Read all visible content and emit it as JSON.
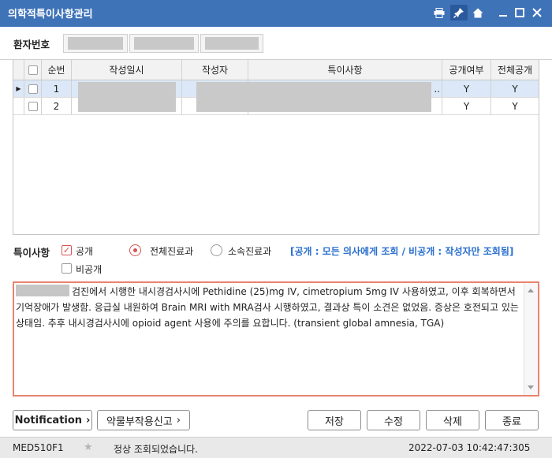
{
  "window": {
    "title": "의학적특이사항관리",
    "icons": [
      "print-icon",
      "pin-icon",
      "home-icon",
      "minimize-icon",
      "maximize-icon",
      "close-icon"
    ]
  },
  "patient": {
    "label": "환자번호"
  },
  "grid": {
    "columns": [
      "순번",
      "작성일시",
      "작성자",
      "특이사항",
      "공개여부",
      "전체공개"
    ],
    "rows": [
      {
        "no": "1",
        "remark_tail": "..",
        "public": "Y",
        "all_public": "Y"
      },
      {
        "no": "2",
        "public": "Y",
        "all_public": "Y"
      }
    ]
  },
  "options": {
    "label": "특이사항",
    "public": "공개",
    "private": "비공개",
    "all_dept": "전체진료과",
    "own_dept": "소속진료과",
    "notice": "[공개 : 모든 의사에게 조회 / 비공개 : 작성자만 조회됨]"
  },
  "memo": {
    "text": "검진에서 시행한 내시경검사시에 Pethidine (25)mg IV, cimetropium 5mg IV 사용하였고, 이후 회복하면서 기억장애가 발생함. 응급실 내원하여 Brain MRI with MRA검사 시행하였고, 결과상 특이 소견은 없었음. 증상은 호전되고 있는 상태임. 추후 내시경검사시에 opioid agent 사용에 주의를 요합니다.   (transient global amnesia, TGA)"
  },
  "buttons": {
    "notification": "Notification",
    "adr_report": "약물부작용신고",
    "save": "저장",
    "edit": "수정",
    "delete": "삭제",
    "close": "종료"
  },
  "status": {
    "screen_id": "MED510F1",
    "message": "정상 조회되었습니다.",
    "datetime": "2022-07-03  10:42:47:305"
  },
  "colors": {
    "titlebar": "#3f73b8",
    "notice": "#2a6fcf",
    "accent_red": "#d9534f",
    "memo_border": "#e8846f"
  }
}
